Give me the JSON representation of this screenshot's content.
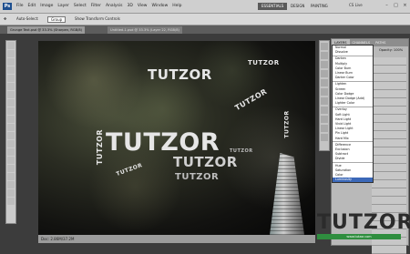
{
  "app": {
    "logo": "Ps",
    "title": "Photoshop"
  },
  "menu": [
    "File",
    "Edit",
    "Image",
    "Layer",
    "Select",
    "Filter",
    "Analysis",
    "3D",
    "View",
    "Window",
    "Help"
  ],
  "workspaces": {
    "essentials": "ESSENTIALS",
    "design": "DESIGN",
    "painting": "PAINTING",
    "cs_live": "CS Live"
  },
  "options": {
    "auto_select": "Auto-Select:",
    "group": "Group",
    "transform": "Show Transform Controls"
  },
  "tabs": [
    "Grunge Text.psd @ 33.3% (Sharpen, RGB/8)",
    "Untitled-1.psd @ 33.3% (Layer 22, RGB/8)"
  ],
  "canvas_words": [
    "TUTZOR",
    "TUTZOR",
    "TUTZOR",
    "TUTZOR",
    "TUTZOR",
    "TUTZOR",
    "TUTZOR",
    "TUTZOR",
    "TUTZOR",
    "TUTZOR"
  ],
  "status": "Doc: 2.86M/37.2M",
  "panel": {
    "tabs": [
      "LAYERS",
      "CHANNELS",
      "PATHS"
    ],
    "blend_selected": "Luminosity",
    "opacity_label": "Opacity: 100%",
    "blend_modes": [
      "Normal",
      "Dissolve",
      "|",
      "Darken",
      "Multiply",
      "Color Burn",
      "Linear Burn",
      "Darker Color",
      "|",
      "Lighten",
      "Screen",
      "Color Dodge",
      "Linear Dodge (Add)",
      "Lighter Color",
      "|",
      "Overlay",
      "Soft Light",
      "Hard Light",
      "Vivid Light",
      "Linear Light",
      "Pin Light",
      "Hard Mix",
      "|",
      "Difference",
      "Exclusion",
      "Subtract",
      "Divide",
      "|",
      "Hue",
      "Saturation",
      "Color",
      "Luminosity"
    ]
  },
  "watermark": {
    "title": "TUTZOR",
    "subtitle": "www.tutzor.com"
  },
  "colors": {
    "accent": "#3b68b8",
    "logo_green": "#2f8e3f"
  }
}
